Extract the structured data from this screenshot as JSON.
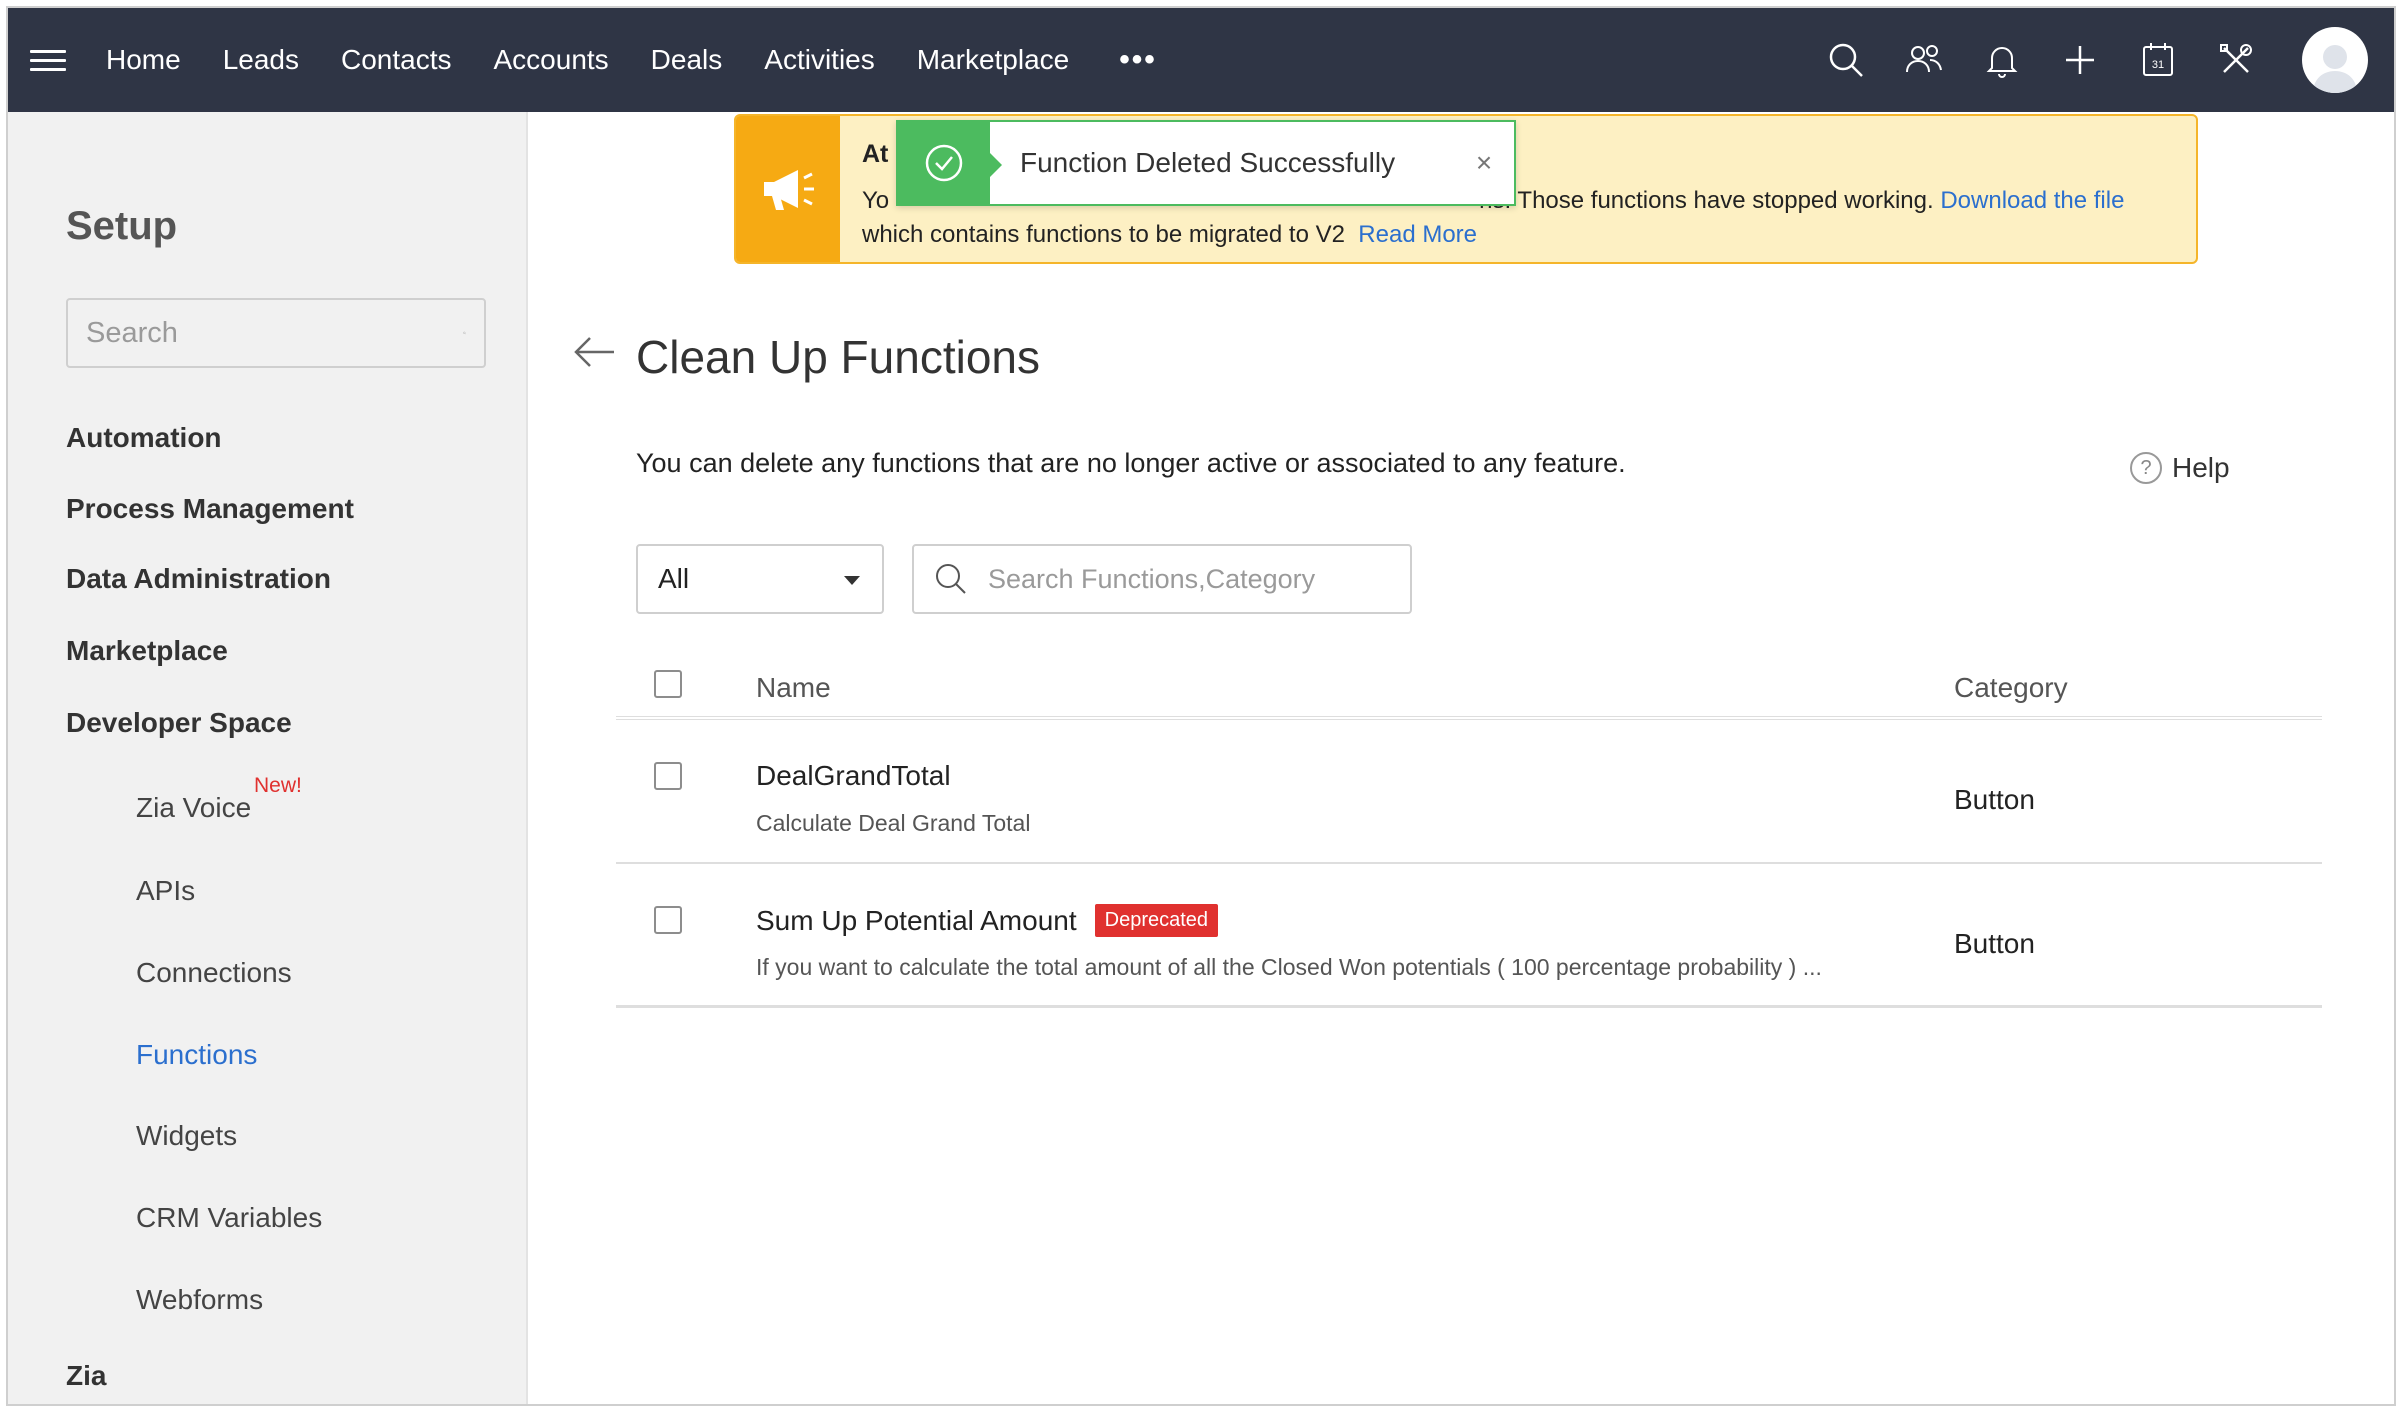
{
  "nav": {
    "links": [
      "Home",
      "Leads",
      "Contacts",
      "Accounts",
      "Deals",
      "Activities",
      "Marketplace"
    ],
    "more": "•••",
    "calendar_day": "31"
  },
  "sidebar": {
    "title": "Setup",
    "search_placeholder": "Search",
    "items": [
      "Automation",
      "Process Management",
      "Data Administration",
      "Marketplace",
      "Developer Space"
    ],
    "sub_items": [
      "Zia Voice",
      "APIs",
      "Connections",
      "Functions",
      "Widgets",
      "CRM Variables",
      "Webforms"
    ],
    "new_badge": "New!",
    "bottom_item": "Zia"
  },
  "banner": {
    "title": "At",
    "text_start": "Yo",
    "text_mid": "ns. Those functions have stopped working.",
    "link_download": "Download the file",
    "text_end": "which contains functions to be migrated to V2",
    "link_read_more": "Read More"
  },
  "toast": {
    "message": "Function Deleted Successfully",
    "close": "×"
  },
  "page": {
    "title": "Clean Up Functions",
    "description": "You can delete any functions that are no longer active or associated to any feature.",
    "help": "Help",
    "help_icon": "?"
  },
  "filter": {
    "selected": "All"
  },
  "fn_search": {
    "placeholder": "Search Functions,Category"
  },
  "table": {
    "headers": {
      "name": "Name",
      "category": "Category"
    },
    "rows": [
      {
        "name": "DealGrandTotal",
        "description": "Calculate Deal Grand Total",
        "category": "Button",
        "badge": ""
      },
      {
        "name": "Sum Up Potential Amount",
        "description": "If you want to calculate the total amount of all the Closed Won potentials ( 100 percentage probability ) ...",
        "category": "Button",
        "badge": "Deprecated"
      }
    ]
  },
  "colors": {
    "nav_bg": "#2f3545",
    "accent_blue": "#2b6fce",
    "success_green": "#4cbb5f",
    "banner_bg": "#fdf0c3",
    "banner_accent": "#f6aa13",
    "badge_red": "#e0312f"
  }
}
